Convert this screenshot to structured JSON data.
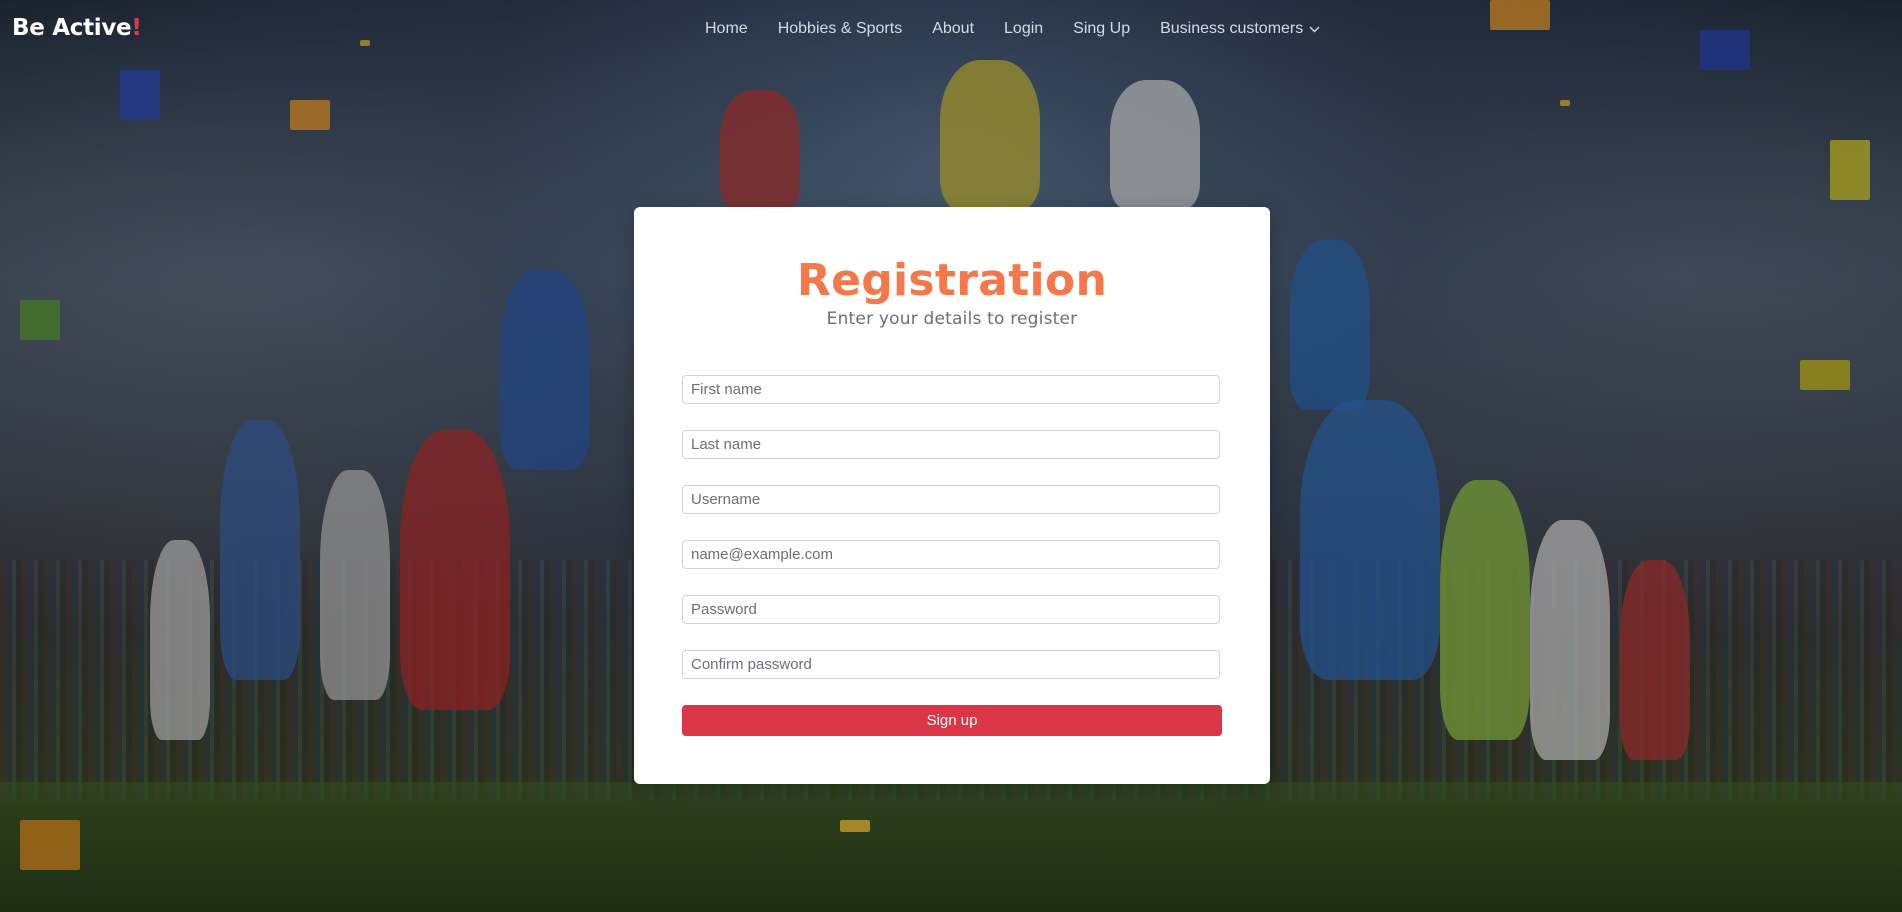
{
  "brand": {
    "name": "Be Active",
    "accent": "!"
  },
  "nav": {
    "home": "Home",
    "hobbies": "Hobbies & Sports",
    "about": "About",
    "login": "Login",
    "signup": "Sing Up",
    "business": "Business customers"
  },
  "registration": {
    "title": "Registration",
    "subtitle": "Enter your details to register",
    "first_name_placeholder": "First name",
    "last_name_placeholder": "Last name",
    "username_placeholder": "Username",
    "email_placeholder": "name@example.com",
    "password_placeholder": "Password",
    "confirm_placeholder": "Confirm password",
    "submit_label": "Sign up"
  },
  "colors": {
    "title_orange": "#f4784a",
    "button_red": "#dc3545",
    "brand_accent_red": "#e03a46"
  },
  "icons": {
    "dropdown": "chevron-down-icon"
  }
}
